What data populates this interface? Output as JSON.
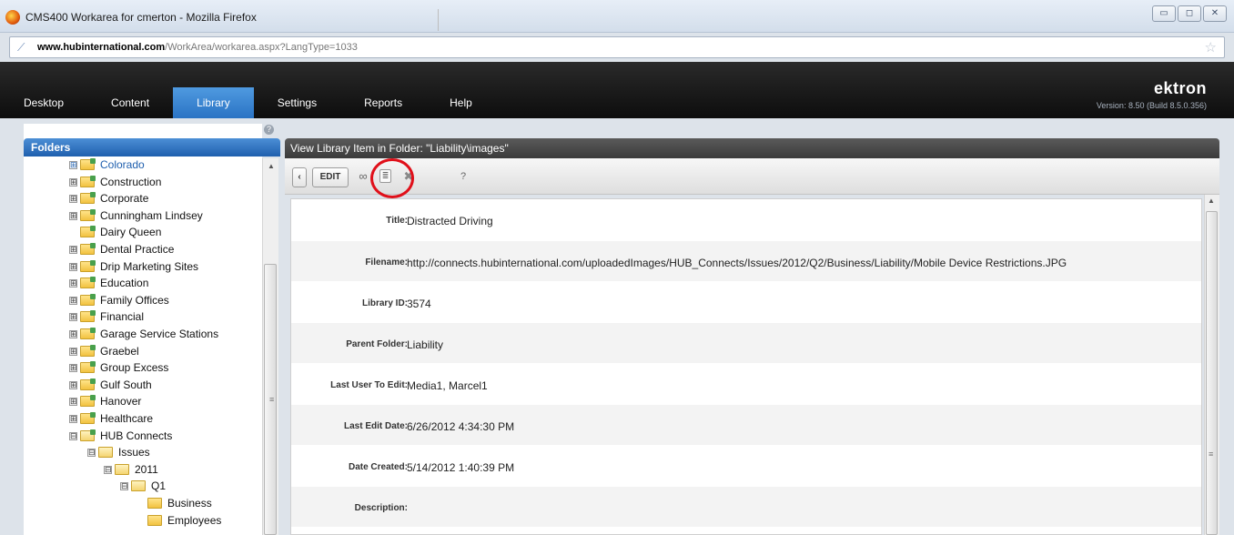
{
  "window": {
    "title": "CMS400 Workarea for cmerton - Mozilla Firefox",
    "buttons": [
      "▭",
      "◻",
      "✕"
    ]
  },
  "browser": {
    "url_domain": "www.hubinternational.com",
    "url_path": "/WorkArea/workarea.aspx?LangType=1033"
  },
  "header": {
    "brand": "ektron",
    "version": "Version: 8.50 (Build 8.5.0.356)",
    "nav": [
      {
        "label": "Desktop",
        "active": false
      },
      {
        "label": "Content",
        "active": false
      },
      {
        "label": "Library",
        "active": true
      },
      {
        "label": "Settings",
        "active": false
      },
      {
        "label": "Reports",
        "active": false
      },
      {
        "label": "Help",
        "active": false
      }
    ]
  },
  "folders": {
    "title": "Folders",
    "items": [
      {
        "label": "Colorado",
        "expander": "⊞",
        "level": 0,
        "cms": true,
        "link": true
      },
      {
        "label": "Construction",
        "expander": "⊞",
        "level": 0,
        "cms": true
      },
      {
        "label": "Corporate",
        "expander": "⊞",
        "level": 0,
        "cms": true
      },
      {
        "label": "Cunningham Lindsey",
        "expander": "⊞",
        "level": 0,
        "cms": true
      },
      {
        "label": "Dairy Queen",
        "expander": "",
        "level": 0,
        "cms": true
      },
      {
        "label": "Dental Practice",
        "expander": "⊞",
        "level": 0,
        "cms": true
      },
      {
        "label": "Drip Marketing Sites",
        "expander": "⊞",
        "level": 0,
        "cms": true
      },
      {
        "label": "Education",
        "expander": "⊞",
        "level": 0,
        "cms": true
      },
      {
        "label": "Family Offices",
        "expander": "⊞",
        "level": 0,
        "cms": true
      },
      {
        "label": "Financial",
        "expander": "⊞",
        "level": 0,
        "cms": true
      },
      {
        "label": "Garage Service Stations",
        "expander": "⊞",
        "level": 0,
        "cms": true
      },
      {
        "label": "Graebel",
        "expander": "⊞",
        "level": 0,
        "cms": true
      },
      {
        "label": "Group Excess",
        "expander": "⊞",
        "level": 0,
        "cms": true
      },
      {
        "label": "Gulf South",
        "expander": "⊞",
        "level": 0,
        "cms": true
      },
      {
        "label": "Hanover",
        "expander": "⊞",
        "level": 0,
        "cms": true
      },
      {
        "label": "Healthcare",
        "expander": "⊞",
        "level": 0,
        "cms": true
      },
      {
        "label": "HUB Connects",
        "expander": "⊟",
        "level": 0,
        "cms": true,
        "open": true
      },
      {
        "label": "Issues",
        "expander": "⊟",
        "level": 1,
        "open": true
      },
      {
        "label": "2011",
        "expander": "⊟",
        "level": 2,
        "open": true
      },
      {
        "label": "Q1",
        "expander": "⊟",
        "level": 3,
        "open": true
      },
      {
        "label": "Business",
        "expander": "",
        "level": 4
      },
      {
        "label": "Employees",
        "expander": "",
        "level": 4
      }
    ]
  },
  "view": {
    "header": "View Library Item in Folder: \"Liability\\images\"",
    "toolbar": {
      "back_label": "‹",
      "edit_label": "EDIT",
      "link_icon": "link-icon",
      "page_icon": "page-icon",
      "delete_icon": "delete-icon",
      "help_icon": "help-icon"
    },
    "fields": [
      {
        "label": "Title:",
        "value": "Distracted Driving"
      },
      {
        "label": "Filename:",
        "value": "http://connects.hubinternational.com/uploadedImages/HUB_Connects/Issues/2012/Q2/Business/Liability/Mobile Device Restrictions.JPG"
      },
      {
        "label": "Library ID:",
        "value": "3574"
      },
      {
        "label": "Parent Folder:",
        "value": "Liability"
      },
      {
        "label": "Last User To Edit:",
        "value": "Media1, Marcel1"
      },
      {
        "label": "Last Edit Date:",
        "value": "6/26/2012 4:34:30 PM"
      },
      {
        "label": "Date Created:",
        "value": "5/14/2012 1:40:39 PM"
      },
      {
        "label": "Description:",
        "value": ""
      }
    ]
  }
}
